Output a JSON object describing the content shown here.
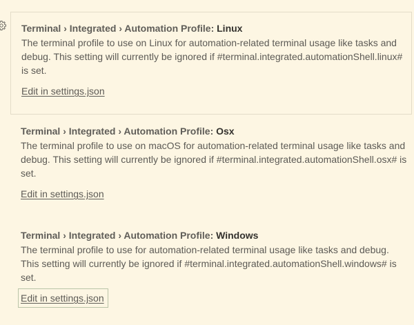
{
  "settings": [
    {
      "category": "Terminal › Integrated › Automation Profile: ",
      "name": "Linux",
      "description": "The terminal profile to use on Linux for automation-related terminal usage like tasks and debug. This setting will currently be ignored if #terminal.integrated.automationShell.linux# is set.",
      "edit_link": "Edit in settings.json"
    },
    {
      "category": "Terminal › Integrated › Automation Profile: ",
      "name": "Osx",
      "description": "The terminal profile to use on macOS for automation-related terminal usage like tasks and debug. This setting will currently be ignored if #terminal.integrated.automationShell.osx# is set.",
      "edit_link": "Edit in settings.json"
    },
    {
      "category": "Terminal › Integrated › Automation Profile: ",
      "name": "Windows",
      "description": "The terminal profile to use for automation-related terminal usage like tasks and debug. This setting will currently be ignored if #terminal.integrated.automationShell.windows# is set.",
      "edit_link": "Edit in settings.json"
    }
  ],
  "icons": {
    "gear": "gear-icon"
  },
  "colors": {
    "background": "#fdf6e3",
    "focus_border": "#e3dcc8",
    "link_focus_outline": "#b9c4a8"
  }
}
